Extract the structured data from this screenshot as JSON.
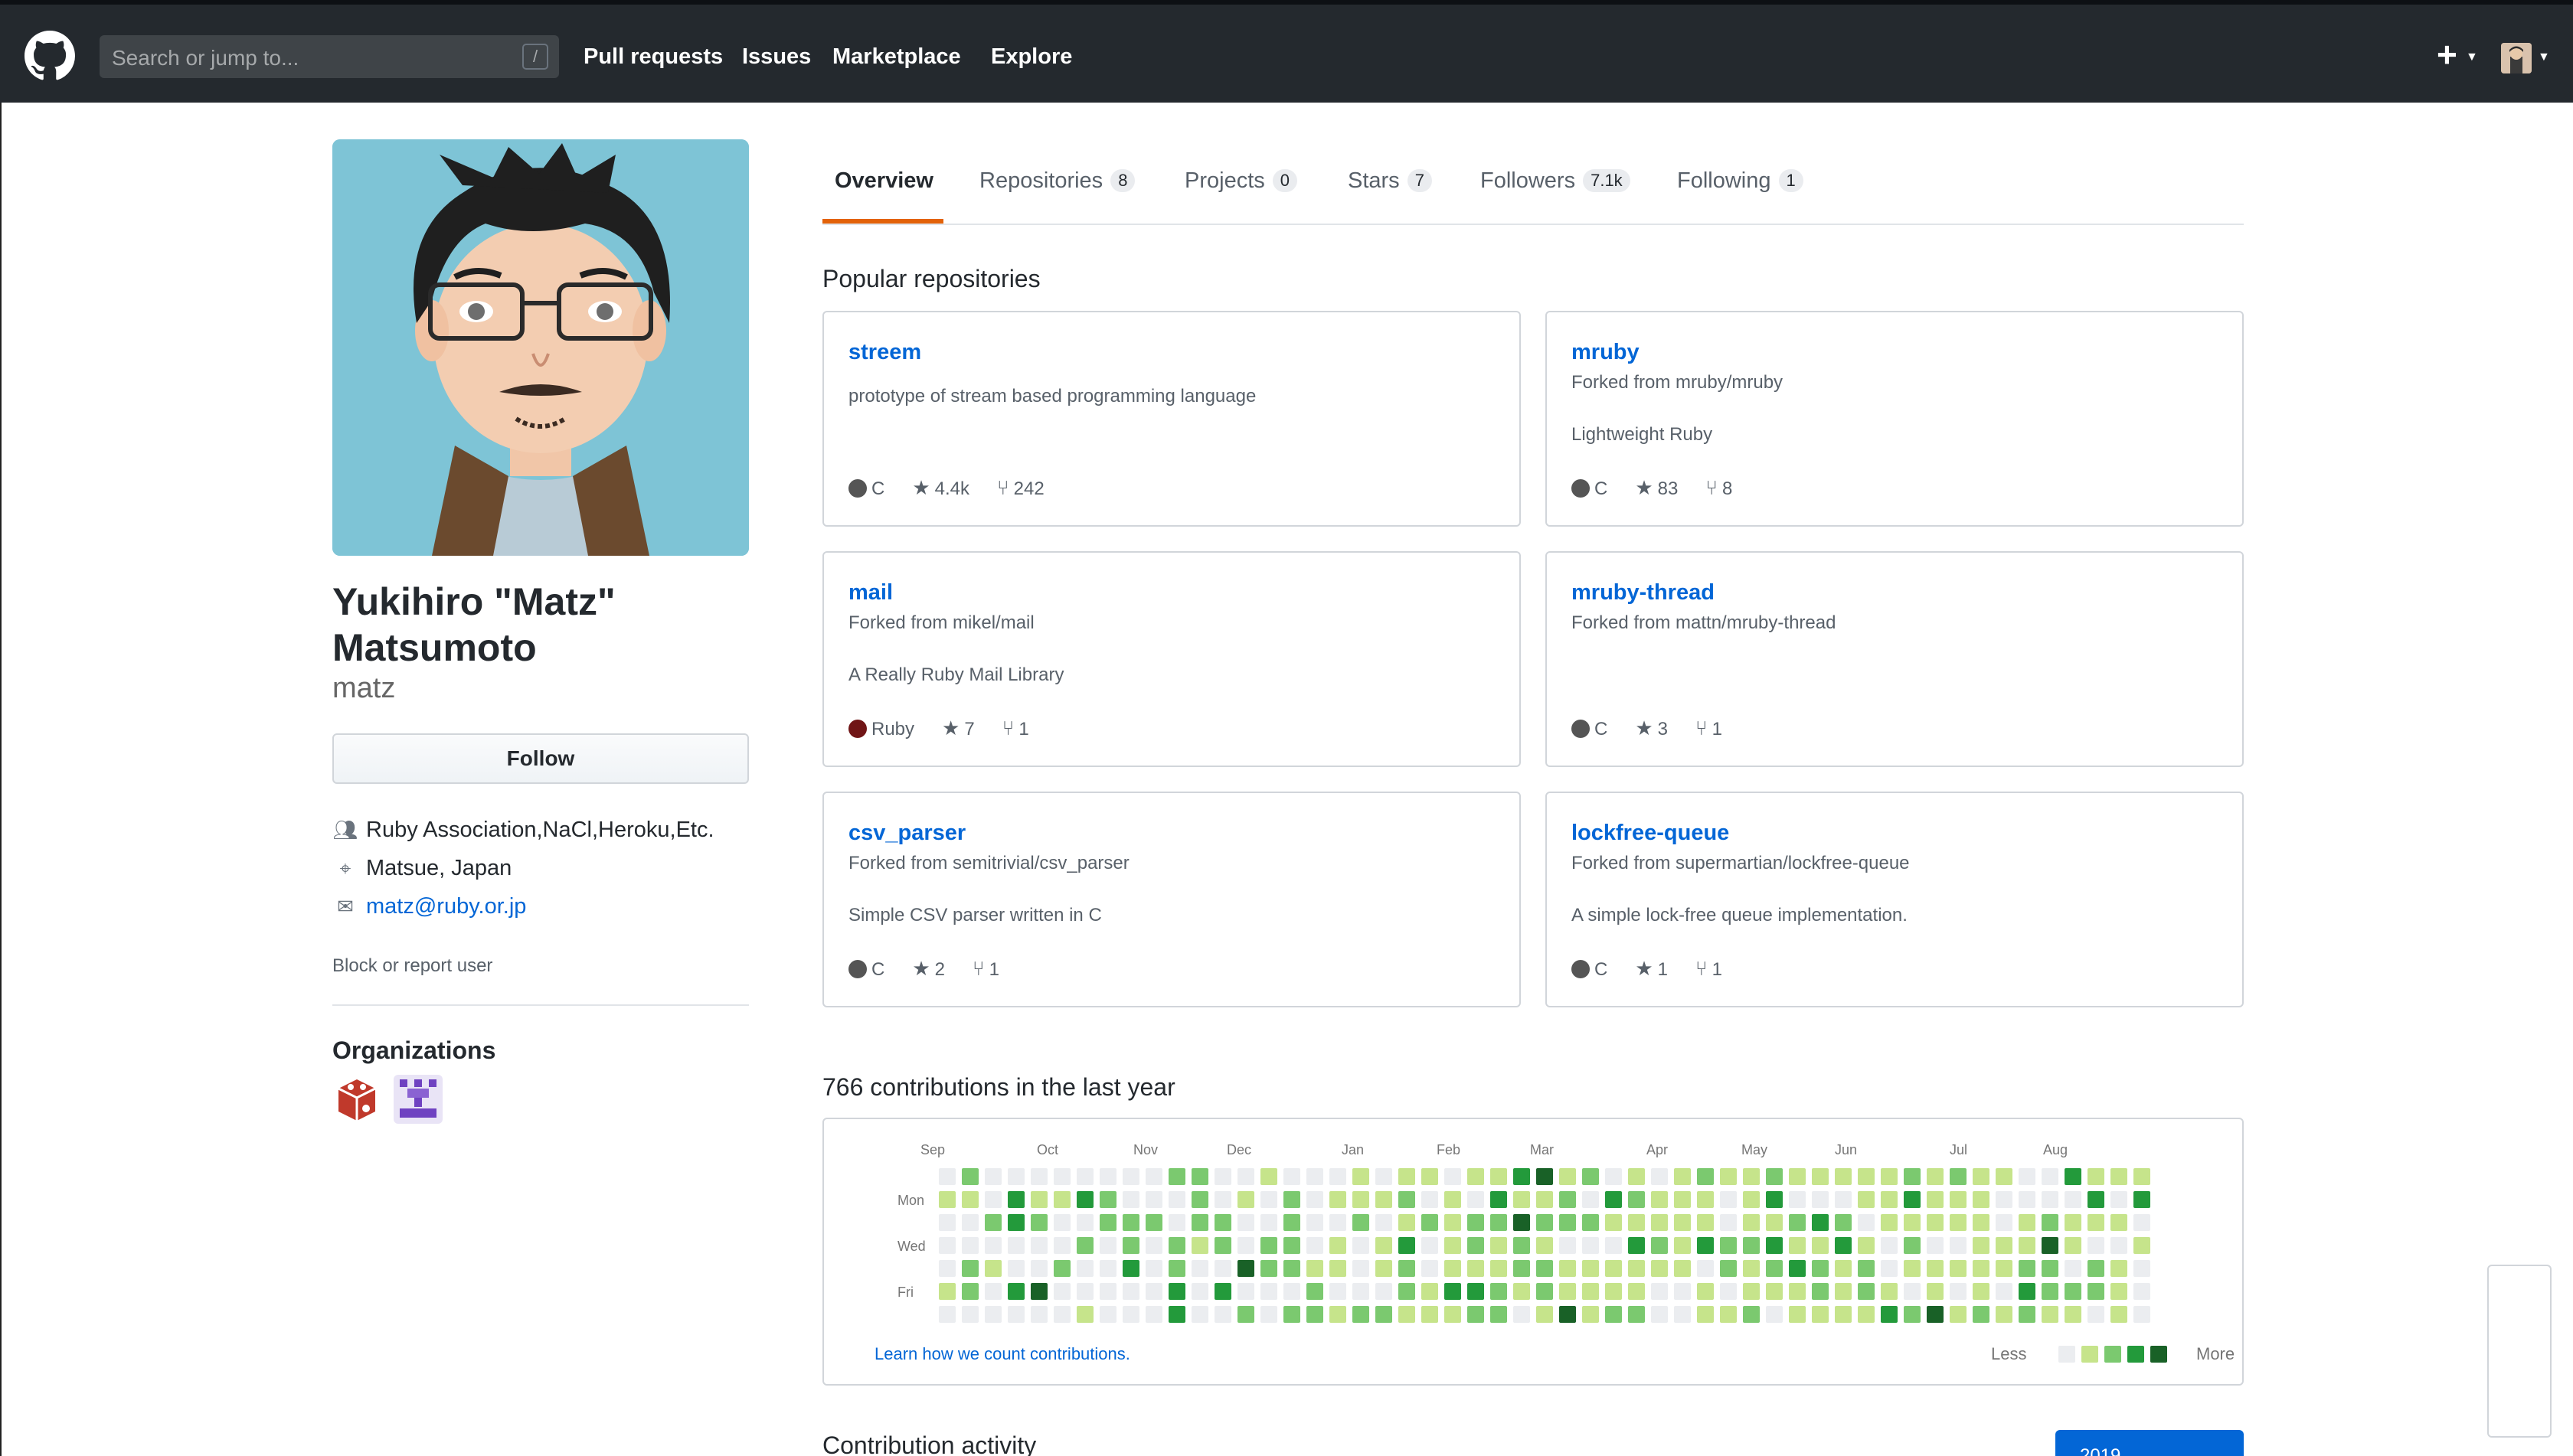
{
  "header": {
    "search_placeholder": "Search or jump to...",
    "search_shortcut": "/",
    "nav": [
      "Pull requests",
      "Issues",
      "Marketplace",
      "Explore"
    ],
    "new_label": "+"
  },
  "profile": {
    "full_name": "Yukihiro \"Matz\" Matsumoto",
    "username": "matz",
    "follow_label": "Follow",
    "company": "Ruby Association,NaCl,Heroku,Etc.",
    "location": "Matsue, Japan",
    "email": "matz@ruby.or.jp",
    "block_label": "Block or report user",
    "organizations_title": "Organizations"
  },
  "tabs": [
    {
      "label": "Overview",
      "count": ""
    },
    {
      "label": "Repositories",
      "count": "8"
    },
    {
      "label": "Projects",
      "count": "0"
    },
    {
      "label": "Stars",
      "count": "7"
    },
    {
      "label": "Followers",
      "count": "7.1k"
    },
    {
      "label": "Following",
      "count": "1"
    }
  ],
  "popular": {
    "title": "Popular repositories",
    "repos": [
      {
        "name": "streem",
        "fork": "",
        "desc": "prototype of stream based programming language",
        "lang": "C",
        "lang_color": "#555555",
        "stars": "4.4k",
        "forks": "242"
      },
      {
        "name": "mruby",
        "fork": "Forked from mruby/mruby",
        "desc": "Lightweight Ruby",
        "lang": "C",
        "lang_color": "#555555",
        "stars": "83",
        "forks": "8"
      },
      {
        "name": "mail",
        "fork": "Forked from mikel/mail",
        "desc": "A Really Ruby Mail Library",
        "lang": "Ruby",
        "lang_color": "#701516",
        "stars": "7",
        "forks": "1"
      },
      {
        "name": "mruby-thread",
        "fork": "Forked from mattn/mruby-thread",
        "desc": "",
        "lang": "C",
        "lang_color": "#555555",
        "stars": "3",
        "forks": "1"
      },
      {
        "name": "csv_parser",
        "fork": "Forked from semitrivial/csv_parser",
        "desc": "Simple CSV parser written in C",
        "lang": "C",
        "lang_color": "#555555",
        "stars": "2",
        "forks": "1"
      },
      {
        "name": "lockfree-queue",
        "fork": "Forked from supermartian/lockfree-queue",
        "desc": "A simple lock-free queue implementation.",
        "lang": "C",
        "lang_color": "#555555",
        "stars": "1",
        "forks": "1"
      }
    ]
  },
  "contributions": {
    "title": "766 contributions in the last year",
    "months": [
      "Sep",
      "Oct",
      "Nov",
      "Dec",
      "Jan",
      "Feb",
      "Mar",
      "Apr",
      "May",
      "Jun",
      "Jul",
      "Aug"
    ],
    "day_labels": [
      "Mon",
      "Wed",
      "Fri"
    ],
    "learn_link": "Learn how we count contributions.",
    "legend_less": "Less",
    "legend_more": "More",
    "colors": [
      "#ebedf0",
      "#c6e48b",
      "#7bc96f",
      "#239a3b",
      "#196127"
    ]
  },
  "activity": {
    "title": "Contribution activity",
    "year": "2019"
  }
}
